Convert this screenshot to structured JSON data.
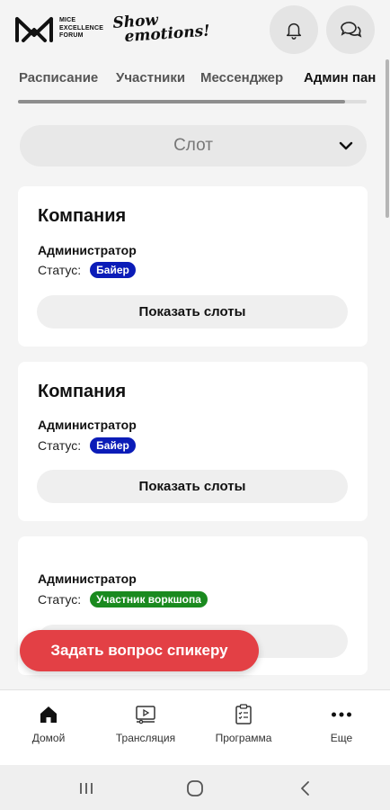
{
  "header": {
    "logo_text": [
      "MICE",
      "EXCELLENCE",
      "FORUM"
    ],
    "logo_script": [
      "Show",
      "emotions!"
    ],
    "icons": {
      "notifications": "bell-icon",
      "messages": "chat-icon"
    }
  },
  "tabs": [
    {
      "label": "Расписание",
      "active": false
    },
    {
      "label": "Участники",
      "active": false
    },
    {
      "label": "Мессенджер",
      "active": false
    },
    {
      "label": "Админ пан",
      "active": true
    }
  ],
  "slot_select": {
    "value": "Слот",
    "icon": "chevron-down-icon"
  },
  "cards": [
    {
      "company": "Компания",
      "role": "Администратор",
      "status_label": "Статус:",
      "status": "Байер",
      "status_color": "#0b1cb8",
      "button": "Показать слоты"
    },
    {
      "company": "Компания",
      "role": "Администратор",
      "status_label": "Статус:",
      "status": "Байер",
      "status_color": "#0b1cb8",
      "button": "Показать слоты"
    },
    {
      "company": "",
      "role": "Администратор",
      "status_label": "Статус:",
      "status": "Участник воркшопа",
      "status_color": "#1a8a1f",
      "button": ""
    }
  ],
  "ask_button": "Задать вопрос спикеру",
  "bottom_nav": [
    {
      "label": "Домой",
      "icon": "home-icon"
    },
    {
      "label": "Трансляция",
      "icon": "broadcast-icon"
    },
    {
      "label": "Программа",
      "icon": "clipboard-icon"
    },
    {
      "label": "Еще",
      "icon": "more-icon"
    }
  ],
  "colors": {
    "accent": "#e34045",
    "badge_blue": "#0b1cb8",
    "badge_green": "#1a8a1f"
  }
}
